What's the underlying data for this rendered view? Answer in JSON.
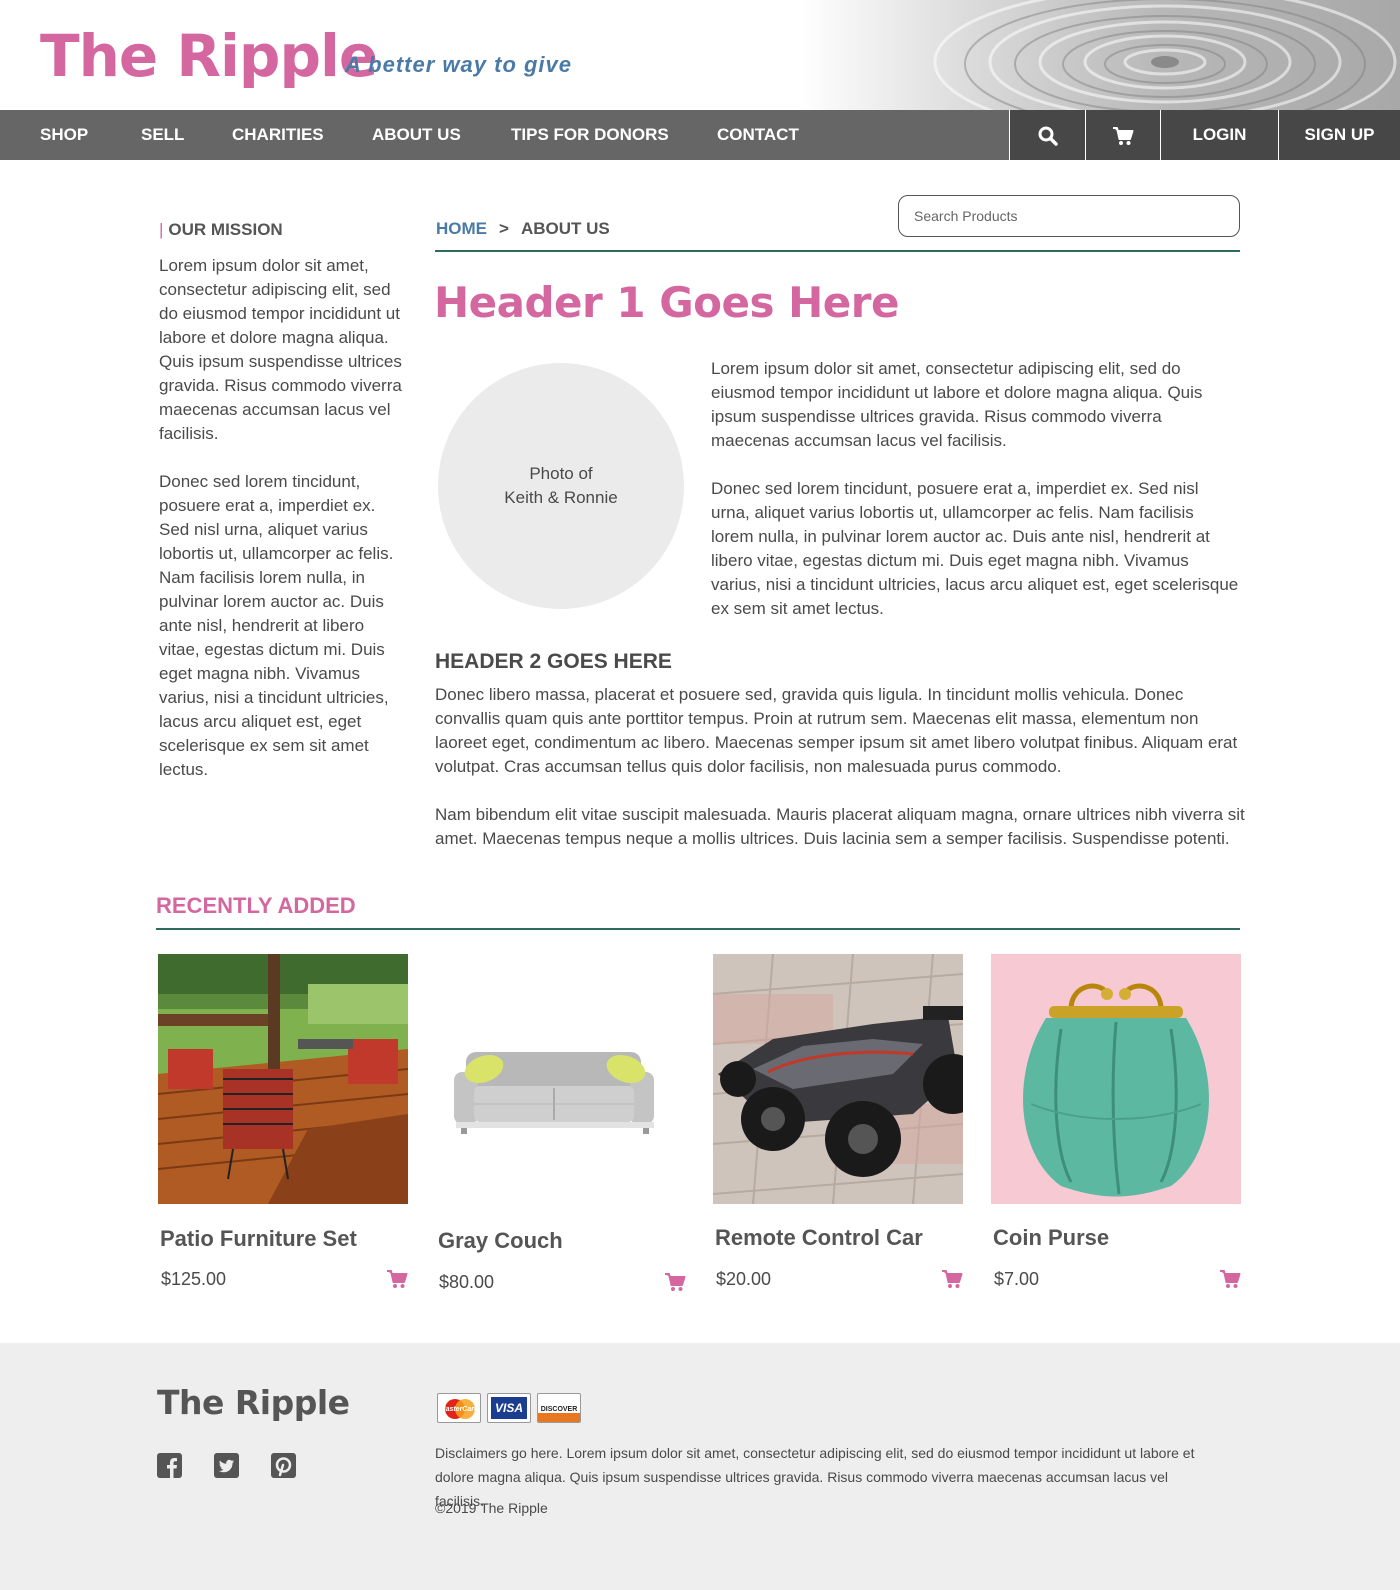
{
  "header": {
    "brand": "The Ripple",
    "tagline": "A better way to give"
  },
  "nav": {
    "links": [
      "SHOP",
      "SELL",
      "CHARITIES",
      "ABOUT US",
      "TIPS FOR DONORS",
      "CONTACT"
    ],
    "login": "LOGIN",
    "signup": "SIGN UP",
    "search_icon": "search-icon",
    "cart_icon": "cart-icon"
  },
  "search": {
    "placeholder": "Search Products"
  },
  "breadcrumb": {
    "home": "HOME",
    "separator": ">",
    "current": "ABOUT US"
  },
  "sidebar": {
    "title": "OUR MISSION",
    "paragraphs": [
      "Lorem ipsum dolor sit amet, consectetur adipiscing elit, sed do eiusmod tempor incididunt ut labore et dolore magna aliqua. Quis ipsum suspendisse ultrices gravida. Risus commodo viverra maecenas accumsan lacus vel facilisis.",
      "Donec sed lorem tincidunt, posuere erat a, imperdiet ex. Sed nisl urna, aliquet varius lobortis ut, ullamcorper ac felis. Nam facilisis lorem nulla, in pulvinar lorem auctor ac. Duis ante nisl, hendrerit at libero vitae, egestas dictum mi. Duis eget magna nibh. Vivamus varius, nisi a tincidunt ultricies, lacus arcu aliquet est, eget scelerisque ex sem sit amet lectus."
    ]
  },
  "main": {
    "h1": "Header 1 Goes Here",
    "photo_line1": "Photo of",
    "photo_line2": "Keith & Ronnie",
    "intro": [
      "Lorem ipsum dolor sit amet, consectetur adipiscing elit, sed do eiusmod tempor incididunt ut labore et dolore magna aliqua. Quis ipsum suspendisse ultrices gravida. Risus commodo viverra maecenas accumsan lacus vel facilisis.",
      "Donec sed lorem tincidunt, posuere erat a, imperdiet ex. Sed nisl urna, aliquet varius lobortis ut, ullamcorper ac felis. Nam facilisis lorem nulla, in pulvinar lorem auctor ac. Duis ante nisl, hendrerit at libero vitae, egestas dictum mi. Duis eget magna nibh. Vivamus varius, nisi a tincidunt ultricies, lacus arcu aliquet est, eget scelerisque ex sem sit amet lectus."
    ],
    "h2": "HEADER 2 GOES HERE",
    "body": [
      "Donec libero massa, placerat et posuere sed, gravida quis ligula. In tincidunt mollis vehicula. Donec convallis quam quis ante porttitor tempus. Proin at rutrum sem. Maecenas elit massa, elementum non laoreet eget, condimentum ac libero. Maecenas semper ipsum sit amet libero volutpat finibus. Aliquam erat volutpat. Cras accumsan tellus quis dolor facilisis, non malesuada purus commodo.",
      "Nam bibendum elit vitae suscipit malesuada. Mauris placerat aliquam magna, ornare ultrices nibh viverra sit amet. Maecenas tempus neque a mollis ultrices. Duis lacinia sem a semper facilisis. Suspendisse potenti."
    ]
  },
  "recent": {
    "title": "RECENTLY ADDED",
    "products": [
      {
        "name": "Patio Furniture Set",
        "price": "$125.00"
      },
      {
        "name": "Gray Couch",
        "price": "$80.00"
      },
      {
        "name": "Remote Control Car",
        "price": "$20.00"
      },
      {
        "name": "Coin Purse",
        "price": "$7.00"
      }
    ]
  },
  "footer": {
    "brand": "The Ripple",
    "social_icons": [
      "facebook-icon",
      "twitter-icon",
      "pinterest-icon"
    ],
    "payment_cards": [
      "MasterCard",
      "VISA",
      "DISCOVER"
    ],
    "disclaimer": "Disclaimers go here. Lorem ipsum dolor sit amet, consectetur adipiscing elit, sed do eiusmod tempor incididunt ut labore et dolore magna aliqua. Quis ipsum suspendisse ultrices gravida. Risus commodo viverra maecenas accumsan lacus vel facilisis.",
    "copyright": "©2019 The Ripple"
  },
  "colors": {
    "brand_pink": "#d4679f",
    "link_blue": "#4a7aa6",
    "nav_gray": "#666666",
    "nav_dark": "#474747",
    "rule_green": "#2f6b5c",
    "footer_bg": "#eeeeee"
  }
}
